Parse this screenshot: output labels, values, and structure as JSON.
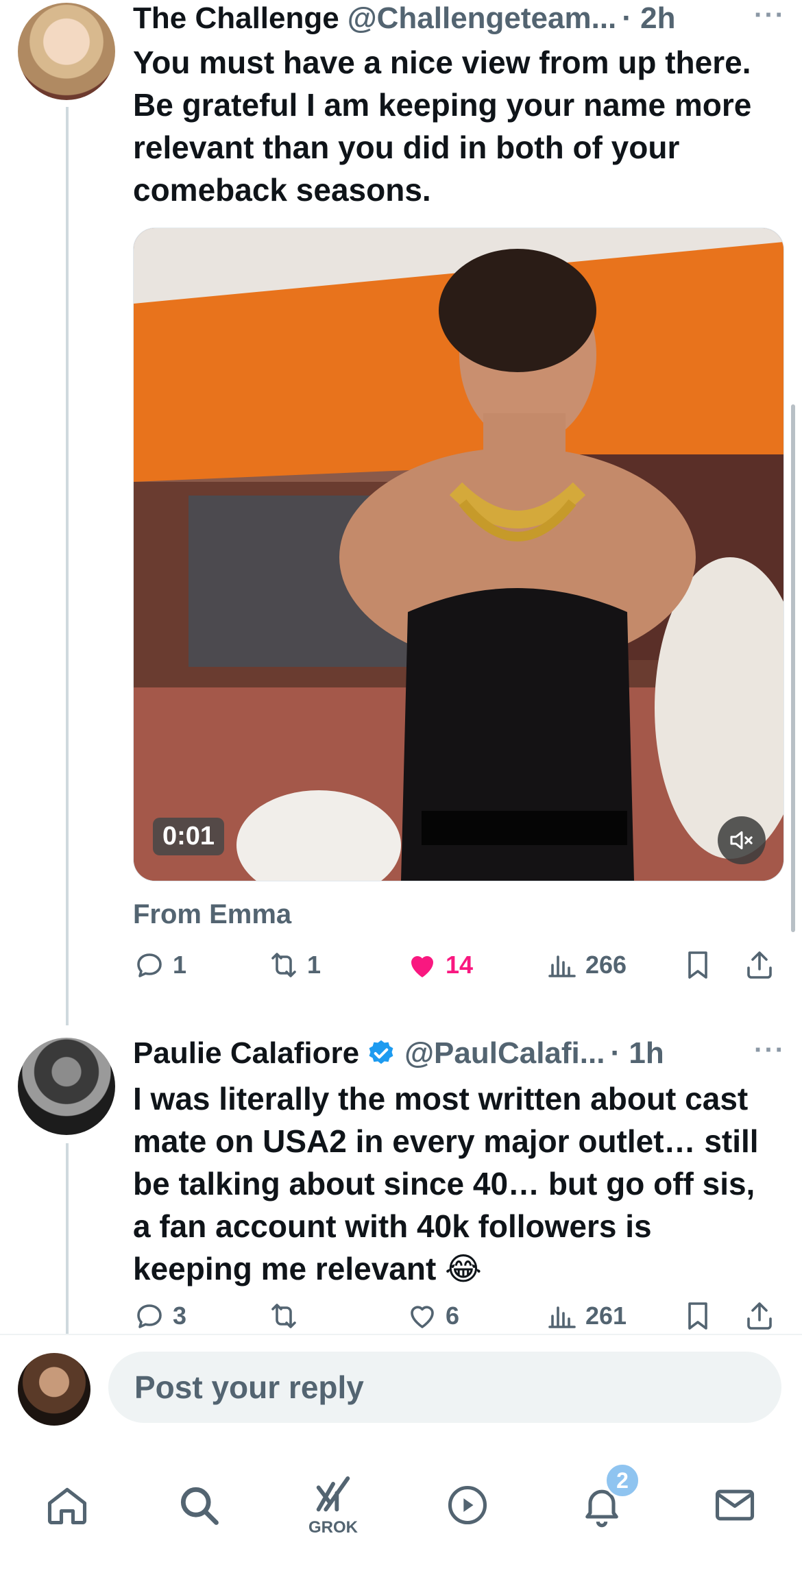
{
  "tweets": [
    {
      "author": "The Challenge",
      "handle": "@Challengeteam...",
      "time": "· 2h",
      "more": "···",
      "text": "You must have a nice view from up there. Be grateful I am keeping your name more relevant than you did in both of your comeback seasons.",
      "video": {
        "duration": "0:01",
        "muted": true
      },
      "source_label": "From Emma",
      "replies": "1",
      "reposts": "1",
      "likes": "14",
      "liked": true,
      "views": "266"
    },
    {
      "author": "Paulie Calafiore",
      "verified": true,
      "handle": "@PaulCalafi...",
      "time": "· 1h",
      "more": "···",
      "text": "I was literally the most written about cast mate on USA2 in every major outlet… still be talking about since 40… but go off sis, a fan account with 40k followers is keeping me relevant 😂",
      "replies": "3",
      "reposts": "",
      "likes": "6",
      "liked": false,
      "views": "261"
    }
  ],
  "reply_bar": {
    "placeholder": "Post your reply"
  },
  "tabbar": {
    "items": [
      {
        "icon": "home-icon"
      },
      {
        "icon": "search-icon"
      },
      {
        "icon": "grok-icon",
        "label": "GROK"
      },
      {
        "icon": "video-icon"
      },
      {
        "icon": "notifications-icon",
        "badge": "2"
      },
      {
        "icon": "messages-icon"
      }
    ]
  },
  "colors": {
    "like": "#f91880",
    "muted_text": "#536471",
    "verified": "#1d9bf0",
    "badge": "#8fc4f0"
  }
}
